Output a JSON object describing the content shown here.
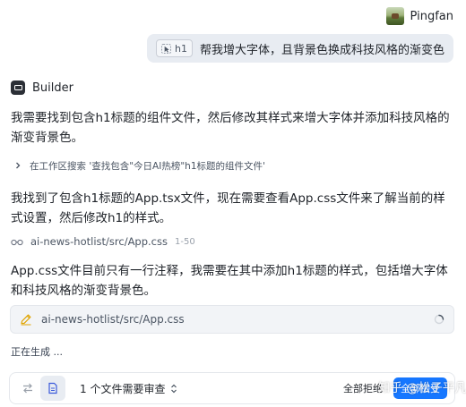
{
  "user": {
    "name": "Pingfan",
    "message": {
      "chip_label": "h1",
      "text": "帮我增大字体，且背景色换成科技风格的渐变色"
    }
  },
  "assistant": {
    "name": "Builder",
    "para1": "我需要找到包含h1标题的组件文件，然后修改其样式来增大字体并添加科技风格的渐变背景色。",
    "search_step": "在工作区搜索 '查找包含\"今日AI热榜\"h1标题的组件文件'",
    "para2": "我找到了包含h1标题的App.tsx文件，现在需要查看App.css文件来了解当前的样式设置，然后修改h1的样式。",
    "read_step": {
      "path": "ai-news-hotlist/src/App.css",
      "lines": "1-50"
    },
    "para3": "App.css文件目前只有一行注释，我需要在其中添加h1标题的样式，包括增大字体和科技风格的渐变背景色。",
    "edit_file": "ai-news-hotlist/src/App.css",
    "status": "正在生成 ..."
  },
  "review_bar": {
    "label": "1 个文件需要审查",
    "reject_all": "全部拒绝",
    "accept_all": "全部接受"
  },
  "watermark": "知乎 @松子平凡",
  "colors": {
    "accent": "#1677ff",
    "bubble": "#e8ecf2",
    "card": "#f2f4f7"
  },
  "icons": {
    "chip": "cursor-select-icon",
    "builder": "builder-icon",
    "search": "chevron-right-icon",
    "read": "glasses-icon",
    "edit": "pen-icon",
    "loading": "spinner-icon"
  }
}
